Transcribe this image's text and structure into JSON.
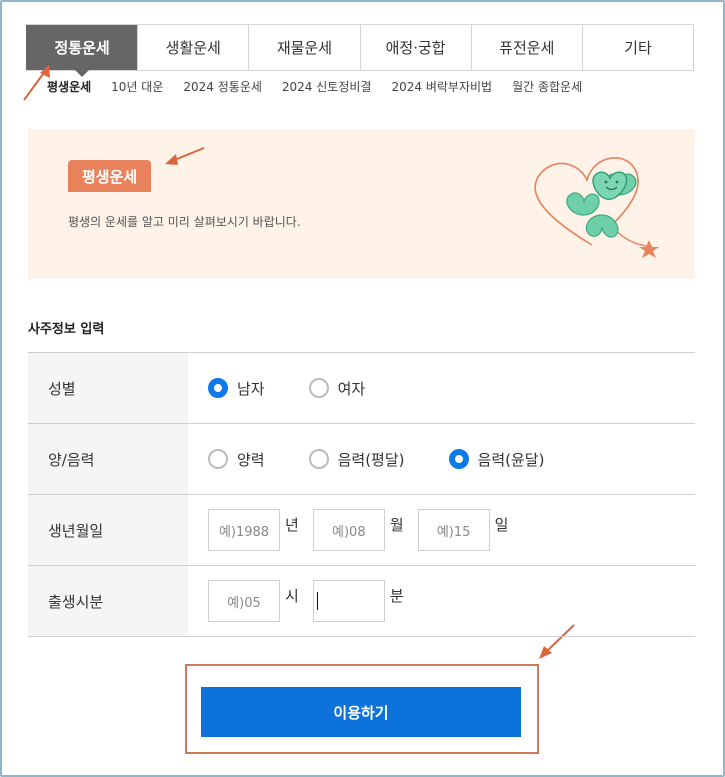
{
  "tabs": [
    {
      "label": "정통운세",
      "active": true
    },
    {
      "label": "생활운세",
      "active": false
    },
    {
      "label": "재물운세",
      "active": false
    },
    {
      "label": "애정·궁합",
      "active": false
    },
    {
      "label": "퓨전운세",
      "active": false
    },
    {
      "label": "기타",
      "active": false
    }
  ],
  "subtabs": [
    {
      "label": "평생운세",
      "active": true
    },
    {
      "label": "10년 대운",
      "active": false
    },
    {
      "label": "2024 정통운세",
      "active": false
    },
    {
      "label": "2024 신토정비결",
      "active": false
    },
    {
      "label": "2024 벼락부자비법",
      "active": false
    },
    {
      "label": "월간 종합운세",
      "active": false
    }
  ],
  "banner": {
    "badge": "평생운세",
    "description": "평생의 운세를 알고 미리 살펴보시기 바랍니다."
  },
  "section": {
    "title": "사주정보 입력"
  },
  "form": {
    "gender": {
      "label": "성별",
      "options": [
        {
          "label": "남자",
          "checked": true
        },
        {
          "label": "여자",
          "checked": false
        }
      ]
    },
    "calendar": {
      "label": "양/음력",
      "options": [
        {
          "label": "양력",
          "checked": false
        },
        {
          "label": "음력(평달)",
          "checked": false
        },
        {
          "label": "음력(윤달)",
          "checked": true
        }
      ]
    },
    "birthdate": {
      "label": "생년월일",
      "year": {
        "placeholder": "예)1988",
        "unit": "년"
      },
      "month": {
        "placeholder": "예)08",
        "unit": "월"
      },
      "day": {
        "placeholder": "예)15",
        "unit": "일"
      }
    },
    "birthtime": {
      "label": "출생시분",
      "hour": {
        "placeholder": "예)05",
        "unit": "시"
      },
      "minute": {
        "placeholder": "",
        "unit": "분"
      }
    }
  },
  "submit": {
    "label": "이용하기"
  },
  "colors": {
    "accent_blue": "#0d72dc",
    "badge_orange": "#e8825b",
    "banner_bg": "#fff3e9",
    "active_tab": "#666666",
    "annotation": "#d9663f"
  }
}
